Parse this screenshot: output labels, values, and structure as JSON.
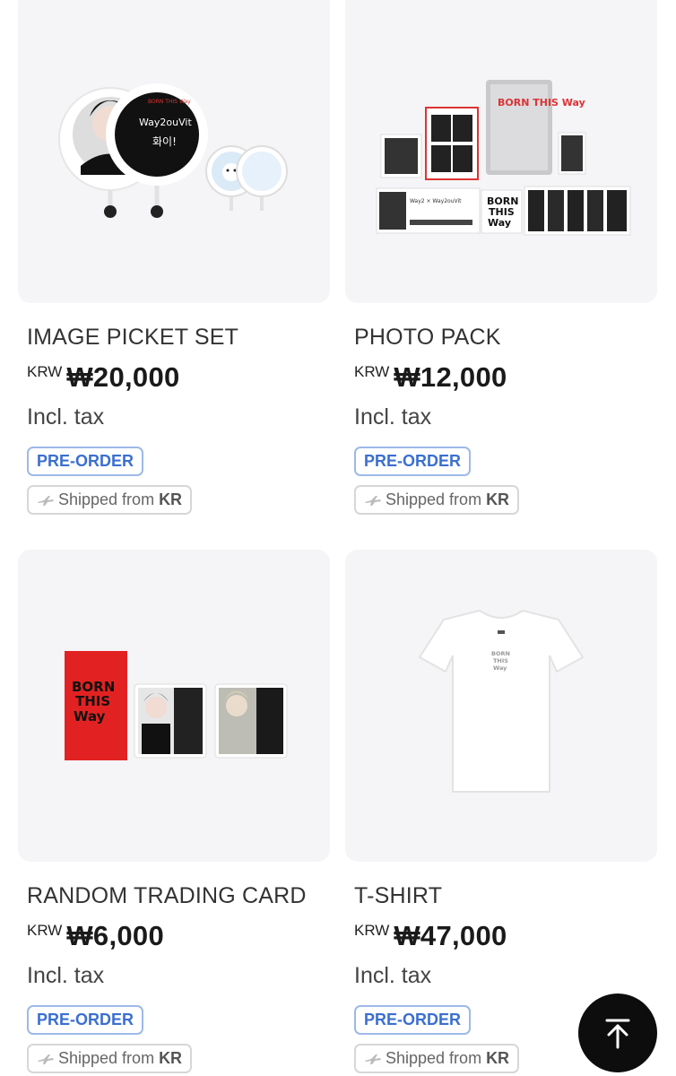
{
  "products": [
    {
      "name": "IMAGE PICKET SET",
      "currency": "KRW",
      "price": "₩20,000",
      "tax": "Incl. tax",
      "badge": "PRE-ORDER",
      "shipping_prefix": "Shipped from",
      "shipping_origin": "KR",
      "image": "picket-set-image",
      "image_text": [
        "BORN THIS Way"
      ]
    },
    {
      "name": "PHOTO PACK",
      "currency": "KRW",
      "price": "₩12,000",
      "tax": "Incl. tax",
      "badge": "PRE-ORDER",
      "shipping_prefix": "Shipped from",
      "shipping_origin": "KR",
      "image": "photo-pack-image",
      "image_text": [
        "BORN THIS Way",
        "BORN",
        "THIS",
        "Way"
      ]
    },
    {
      "name": "RANDOM TRADING CARD",
      "currency": "KRW",
      "price": "₩6,000",
      "tax": "Incl. tax",
      "badge": "PRE-ORDER",
      "shipping_prefix": "Shipped from",
      "shipping_origin": "KR",
      "image": "trading-card-image",
      "image_text": [
        "BORN",
        "THIS",
        "Way"
      ]
    },
    {
      "name": "T-SHIRT",
      "currency": "KRW",
      "price": "₩47,000",
      "tax": "Incl. tax",
      "badge": "PRE-ORDER",
      "shipping_prefix": "Shipped from",
      "shipping_origin": "KR",
      "image": "tshirt-image",
      "image_text": [
        "BORN",
        "THIS",
        "Way"
      ]
    }
  ],
  "scroll_top_icon": "arrow-up-to-top-icon",
  "colors": {
    "preorder_text": "#3b6fd0",
    "preorder_border": "#9db9e8",
    "card_bg": "#f5f5f7",
    "top_button": "#0d0d0d"
  }
}
